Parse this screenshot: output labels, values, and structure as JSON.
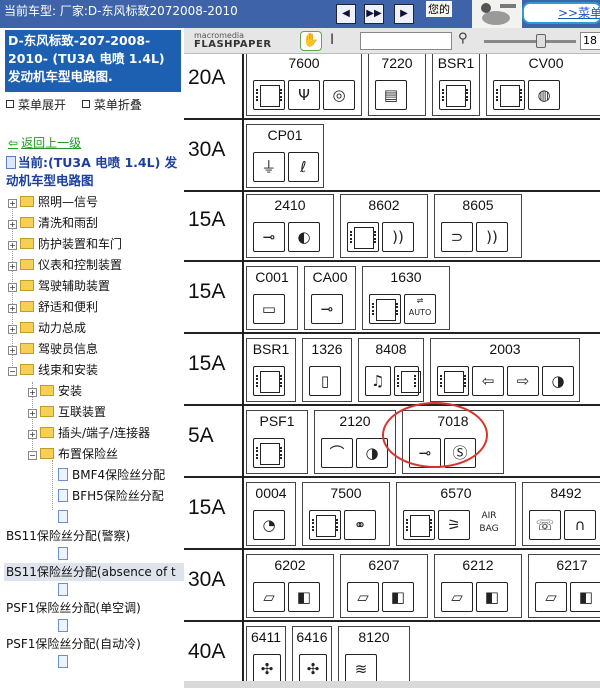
{
  "topbar": {
    "title": "当前车型:  厂家:D-东风标致2072008-2010",
    "greeting": "您的",
    "menu_link": ">>菜单",
    "nav_prev": "◀",
    "nav_pause": "▶▶",
    "nav_next": "▶"
  },
  "sidebar": {
    "heading": "D-东风标致-207-2008-2010- (TU3A 电喷 1.4L) 发动机车型电路图.",
    "expand_menu": "菜单展开",
    "collapse_menu": "菜单折叠",
    "back": "返回上一级",
    "current": "当前:(TU3A 电喷 1.4L) 发动机车型电路图",
    "tree": [
      {
        "label": "照明—信号"
      },
      {
        "label": "清洗和雨刮"
      },
      {
        "label": "防护装置和车门"
      },
      {
        "label": "仪表和控制装置"
      },
      {
        "label": "驾驶辅助装置"
      },
      {
        "label": "舒适和便利"
      },
      {
        "label": "动力总成"
      },
      {
        "label": "驾驶员信息"
      },
      {
        "label": "线束和安装"
      }
    ],
    "subtree": [
      {
        "label": "安装"
      },
      {
        "label": "互联装置"
      },
      {
        "label": "插头/端子/连接器"
      },
      {
        "label": "布置保险丝"
      }
    ],
    "docs": [
      {
        "label": "BMF4保险丝分配"
      },
      {
        "label": "BFH5保险丝分配"
      },
      {
        "label": ""
      },
      {
        "label": "BS11保险丝分配(警察)"
      },
      {
        "label": "BS11保险丝分配(absence of t"
      },
      {
        "label": "PSF1保险丝分配(单空调)"
      },
      {
        "label": "PSF1保险丝分配(自动冷)"
      }
    ]
  },
  "flashbar": {
    "logo_top": "macromedia",
    "logo_bottom": "FLASHPAPER",
    "zoom": "18",
    "hand_icon": "hand-icon",
    "search_icon": "magnifier-icon"
  },
  "fuse_table": {
    "rows": [
      {
        "amp": "20A",
        "boxes": [
          {
            "code": "7600",
            "icons": [
              "relay",
              "antenna",
              "speaker"
            ]
          },
          {
            "code": "7220",
            "icons": [
              "display"
            ]
          },
          {
            "code": "BSR1",
            "icons": [
              "relay"
            ]
          },
          {
            "code": "CV00",
            "icons": [
              "relay",
              "wheel"
            ]
          }
        ]
      },
      {
        "amp": "30A",
        "boxes": [
          {
            "code": "CP01",
            "icons": [
              "plug",
              "lighter"
            ]
          }
        ]
      },
      {
        "amp": "15A",
        "boxes": [
          {
            "code": "2410",
            "icons": [
              "relay-switch",
              "headlamp"
            ]
          },
          {
            "code": "8602",
            "icons": [
              "relay",
              "sensor"
            ]
          },
          {
            "code": "8605",
            "icons": [
              "horn",
              "sensor"
            ]
          }
        ]
      },
      {
        "amp": "15A",
        "boxes": [
          {
            "code": "C001",
            "icons": [
              "socket"
            ]
          },
          {
            "code": "CA00",
            "icons": [
              "key"
            ]
          },
          {
            "code": "1630",
            "icons": [
              "relay",
              "auto-gearbox"
            ]
          }
        ]
      },
      {
        "amp": "15A",
        "boxes": [
          {
            "code": "BSR1",
            "icons": [
              "relay"
            ]
          },
          {
            "code": "1326",
            "icons": [
              "fuse"
            ]
          },
          {
            "code": "8408",
            "icons": [
              "music",
              "relay"
            ]
          },
          {
            "code": "2003",
            "icons": [
              "relay",
              "arrow-left",
              "arrow-right",
              "lamp"
            ]
          }
        ]
      },
      {
        "amp": "5A",
        "boxes": [
          {
            "code": "PSF1",
            "icons": [
              "relay"
            ]
          },
          {
            "code": "2120",
            "icons": [
              "wiper",
              "lamp"
            ]
          },
          {
            "code": "7018",
            "icons": [
              "relay-switch",
              "abs"
            ]
          }
        ]
      },
      {
        "amp": "15A",
        "boxes": [
          {
            "code": "0004",
            "icons": [
              "gauge"
            ]
          },
          {
            "code": "7500",
            "icons": [
              "relay",
              "car-sensor"
            ]
          },
          {
            "code": "6570",
            "icons": [
              "relay",
              "seatbelt",
              "airbag"
            ]
          },
          {
            "code": "8492",
            "icons": [
              "phone",
              "headphones"
            ]
          }
        ]
      },
      {
        "amp": "30A",
        "boxes": [
          {
            "code": "6202",
            "icons": [
              "window",
              "window-2"
            ]
          },
          {
            "code": "6207",
            "icons": [
              "window",
              "window-2"
            ]
          },
          {
            "code": "6212",
            "icons": [
              "window",
              "window-2"
            ]
          },
          {
            "code": "6217",
            "icons": [
              "window",
              "window-2"
            ]
          }
        ]
      },
      {
        "amp": "40A",
        "boxes": [
          {
            "code": "6411",
            "icons": [
              "fan"
            ]
          },
          {
            "code": "6416",
            "icons": [
              "fan"
            ]
          },
          {
            "code": "8120",
            "icons": [
              "rear-defrost"
            ]
          }
        ]
      }
    ],
    "auto_label": "AUTO",
    "airbag_label": "AIR BAG"
  }
}
